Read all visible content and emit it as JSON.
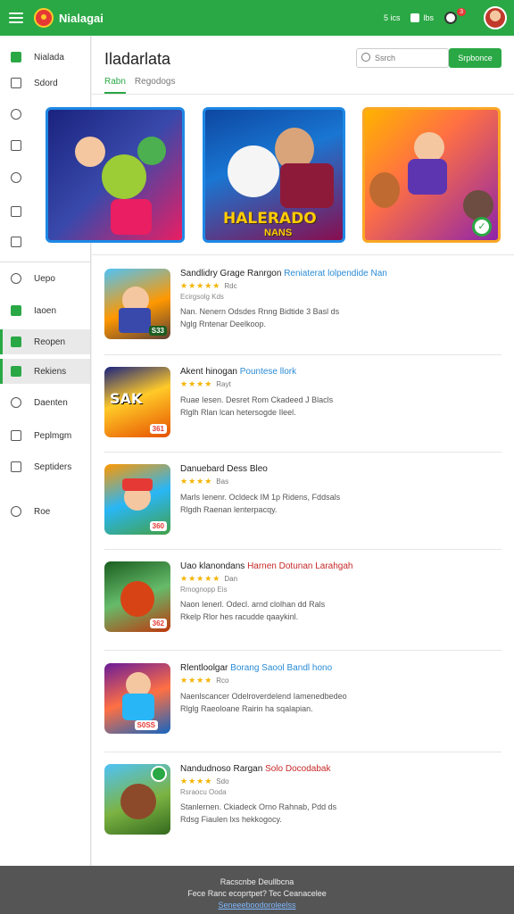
{
  "app": {
    "name": "Nialagai"
  },
  "topbar": {
    "item1": "5 ics",
    "item2": "lbs",
    "badge": "3"
  },
  "sidebar": {
    "items": [
      {
        "label": "Nialada",
        "icon": "home-icon"
      },
      {
        "label": "Sdord",
        "icon": "calendar-icon"
      },
      {
        "label": "",
        "icon": "clock-icon"
      },
      {
        "label": "",
        "icon": "grid-icon"
      },
      {
        "label": "",
        "icon": "tag-icon"
      },
      {
        "label": "",
        "icon": "chart-icon"
      },
      {
        "label": "",
        "icon": "upload-icon"
      },
      {
        "label": "Uepo",
        "icon": "link-icon"
      },
      {
        "label": "Iaoen",
        "icon": "tile-icon"
      },
      {
        "label": "Reopen",
        "icon": "doc-icon"
      },
      {
        "label": "Rekiens",
        "icon": "badge-icon"
      },
      {
        "label": "Daenten",
        "icon": "shield-icon"
      },
      {
        "label": "Peplmgm",
        "icon": "card-icon"
      },
      {
        "label": "Septiders",
        "icon": "chat-icon"
      },
      {
        "label": "Roe",
        "icon": "help-icon"
      }
    ]
  },
  "main": {
    "title": "Iladarlata",
    "search": {
      "placeholder": "Ssrch",
      "button": "Srpbonce"
    },
    "tabs": [
      "Rabn",
      "Regodogs"
    ]
  },
  "banner": {
    "title": "HALERADO",
    "subtitle": "NANS"
  },
  "games": [
    {
      "title": "Sandlidry Grage Ranrgon",
      "title_accent": "Reniaterat lolpendide Nan",
      "rating": "★★★★★",
      "rating_text": "Rdc",
      "meta": "Ecirgsolg Kds",
      "line1": "Nan. Nenern Odsdes Rnng Bidtide 3 Basl ds",
      "line2": "Nglg Rntenar Deelkoop.",
      "badge": "S33"
    },
    {
      "title": "Akent hinogan",
      "title_accent": "Pountese llork",
      "rating": "★★★★",
      "rating_text": "Rayt",
      "meta": "",
      "line1": "Ruae Iesen. Desret Rom Ckadeed J Blacls",
      "line2": "Rlglh Rlan lcan hetersogde Ileel.",
      "badge": "361"
    },
    {
      "title": "Danuebard Dess Bleo",
      "title_accent": "",
      "rating": "★★★★",
      "rating_text": "Bas",
      "meta": "",
      "line1": "Marls Ienenr. Ocldeck IM 1p Ridens, Fddsals",
      "line2": "Rlgdh Raenan lenterpacqy.",
      "badge": "360"
    },
    {
      "title": "Uao klanondans",
      "title_accent": "Harnen Dotunan Larahgah",
      "rating": "★★★★★",
      "rating_text": "Dan",
      "meta": "Rmognopp Eis",
      "line1": "Naon Ienerl. Odecl. arnd clolhan dd Rals",
      "line2": "Rkelp Rlor hes racudde qaaykinl.",
      "badge": "362"
    },
    {
      "title": "Rlentloolgar",
      "title_accent": "Borang Saool Bandl hono",
      "rating": "★★★★",
      "rating_text": "Rco",
      "meta": "",
      "line1": "Naenlscancer Odelroverdelend Iamenedbedeo",
      "line2": "Rlglg Raeoloane Rairin ha sqalapian.",
      "badge": "S0SS"
    },
    {
      "title": "Nandudnoso Rargan",
      "title_accent": "Solo Docodabak",
      "rating": "★★★★",
      "rating_text": "Sdo",
      "meta": "Rsraocu Ooda",
      "line1": "Stanlernen. Ckiadeck Orno Rahnab, Pdd ds",
      "line2": "Rdsg Fiaulen lxs hekkogocy.",
      "badge": ""
    }
  ],
  "footer": {
    "line1": "Racscnbe Deullbcna",
    "line2": "Fece Ranc ecoprtpet? Tec Ceanacelee",
    "link": "Seneeeboodoroleelss"
  }
}
